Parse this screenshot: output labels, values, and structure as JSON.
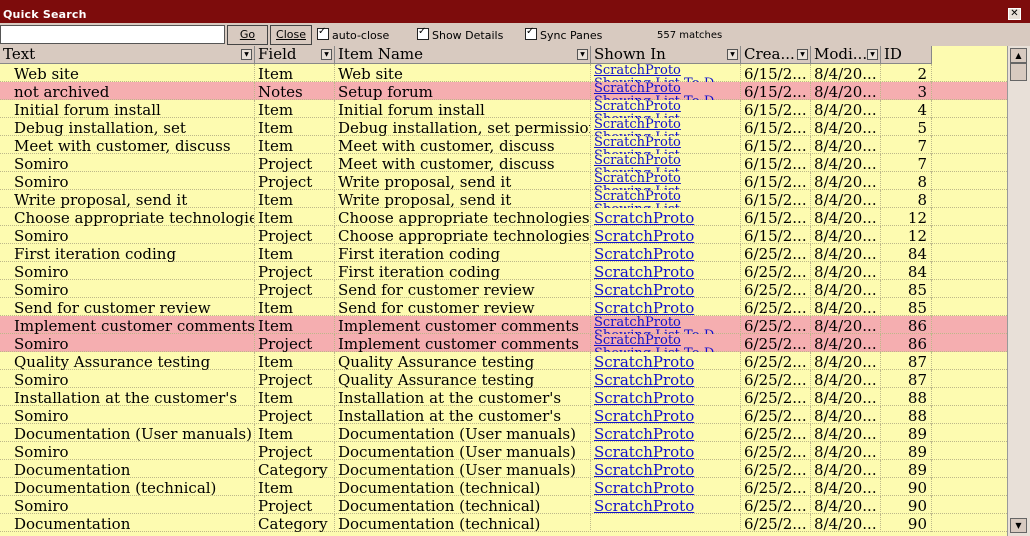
{
  "window": {
    "title": "Quick Search",
    "close_glyph": "✕"
  },
  "toolbar": {
    "search_value": "",
    "go_label": "Go",
    "close_label": "Close",
    "auto_close_label": "auto-close",
    "show_details_label": "Show Details",
    "sync_panes_label": "Sync Panes",
    "matches": "557 matches"
  },
  "columns": [
    "Text",
    "Field",
    "Item Name",
    "Shown In",
    "Crea...",
    "Modi...",
    "ID"
  ],
  "rows": [
    {
      "text": "Web site",
      "field": "Item",
      "item": "Web site",
      "shown": "ScratchProto\nShowing List To-D",
      "created": "6/15/2...",
      "modified": "8/4/20...",
      "id": "2",
      "hl": false
    },
    {
      "text": "not archived",
      "field": "Notes",
      "item": "Setup forum",
      "shown": "ScratchProto\nShowing List To-D",
      "created": "6/15/2...",
      "modified": "8/4/20...",
      "id": "3",
      "hl": true
    },
    {
      "text": "Initial forum install",
      "field": "Item",
      "item": "Initial forum install",
      "shown": "ScratchProto\nShowing List",
      "created": "6/15/2...",
      "modified": "8/4/20...",
      "id": "4",
      "hl": false
    },
    {
      "text": "Debug installation, set",
      "field": "Item",
      "item": "Debug installation, set permissions",
      "shown": "ScratchProto\nShowing List",
      "created": "6/15/2...",
      "modified": "8/4/20...",
      "id": "5",
      "hl": false
    },
    {
      "text": "Meet with customer, discuss",
      "field": "Item",
      "item": "Meet with customer, discuss",
      "shown": "ScratchProto\nShowing List",
      "created": "6/15/2...",
      "modified": "8/4/20...",
      "id": "7",
      "hl": false
    },
    {
      "text": "Somiro",
      "field": "Project",
      "item": "Meet with customer, discuss",
      "shown": "ScratchProto\nShowing List",
      "created": "6/15/2...",
      "modified": "8/4/20...",
      "id": "7",
      "hl": false
    },
    {
      "text": "Somiro",
      "field": "Project",
      "item": "Write proposal, send it",
      "shown": "ScratchProto\nShowing List",
      "created": "6/15/2...",
      "modified": "8/4/20...",
      "id": "8",
      "hl": false
    },
    {
      "text": "Write proposal, send it",
      "field": "Item",
      "item": "Write proposal, send it",
      "shown": "ScratchProto\nShowing List",
      "created": "6/15/2...",
      "modified": "8/4/20...",
      "id": "8",
      "hl": false
    },
    {
      "text": "Choose appropriate technologies",
      "field": "Item",
      "item": "Choose appropriate technologies",
      "shown": "ScratchProto",
      "created": "6/15/2...",
      "modified": "8/4/20...",
      "id": "12",
      "hl": false
    },
    {
      "text": "Somiro",
      "field": "Project",
      "item": "Choose appropriate technologies",
      "shown": "ScratchProto",
      "created": "6/15/2...",
      "modified": "8/4/20...",
      "id": "12",
      "hl": false
    },
    {
      "text": "First iteration coding",
      "field": "Item",
      "item": "First iteration coding",
      "shown": "ScratchProto",
      "created": "6/25/2...",
      "modified": "8/4/20...",
      "id": "84",
      "hl": false
    },
    {
      "text": "Somiro",
      "field": "Project",
      "item": "First iteration coding",
      "shown": "ScratchProto",
      "created": "6/25/2...",
      "modified": "8/4/20...",
      "id": "84",
      "hl": false
    },
    {
      "text": "Somiro",
      "field": "Project",
      "item": "Send for customer review",
      "shown": "ScratchProto",
      "created": "6/25/2...",
      "modified": "8/4/20...",
      "id": "85",
      "hl": false
    },
    {
      "text": "Send for customer review",
      "field": "Item",
      "item": "Send for customer review",
      "shown": "ScratchProto",
      "created": "6/25/2...",
      "modified": "8/4/20...",
      "id": "85",
      "hl": false
    },
    {
      "text": "Implement customer comments",
      "field": "Item",
      "item": "Implement customer comments",
      "shown": "ScratchProto\nShowing List To-D",
      "created": "6/25/2...",
      "modified": "8/4/20...",
      "id": "86",
      "hl": true
    },
    {
      "text": "Somiro",
      "field": "Project",
      "item": "Implement customer comments",
      "shown": "ScratchProto\nShowing List To-D",
      "created": "6/25/2...",
      "modified": "8/4/20...",
      "id": "86",
      "hl": true
    },
    {
      "text": "Quality Assurance testing",
      "field": "Item",
      "item": "Quality Assurance testing",
      "shown": "ScratchProto",
      "created": "6/25/2...",
      "modified": "8/4/20...",
      "id": "87",
      "hl": false
    },
    {
      "text": "Somiro",
      "field": "Project",
      "item": "Quality Assurance testing",
      "shown": "ScratchProto",
      "created": "6/25/2...",
      "modified": "8/4/20...",
      "id": "87",
      "hl": false
    },
    {
      "text": "Installation at the customer's",
      "field": "Item",
      "item": "Installation at the customer's",
      "shown": "ScratchProto",
      "created": "6/25/2...",
      "modified": "8/4/20...",
      "id": "88",
      "hl": false
    },
    {
      "text": "Somiro",
      "field": "Project",
      "item": "Installation at the customer's",
      "shown": "ScratchProto",
      "created": "6/25/2...",
      "modified": "8/4/20...",
      "id": "88",
      "hl": false
    },
    {
      "text": "Documentation (User manuals)",
      "field": "Item",
      "item": "Documentation (User manuals)",
      "shown": "ScratchProto",
      "created": "6/25/2...",
      "modified": "8/4/20...",
      "id": "89",
      "hl": false
    },
    {
      "text": "Somiro",
      "field": "Project",
      "item": "Documentation (User manuals)",
      "shown": "ScratchProto",
      "created": "6/25/2...",
      "modified": "8/4/20...",
      "id": "89",
      "hl": false
    },
    {
      "text": "Documentation",
      "field": "Category",
      "item": "Documentation (User manuals)",
      "shown": "ScratchProto",
      "created": "6/25/2...",
      "modified": "8/4/20...",
      "id": "89",
      "hl": false
    },
    {
      "text": "Documentation (technical)",
      "field": "Item",
      "item": "Documentation (technical)",
      "shown": "ScratchProto",
      "created": "6/25/2...",
      "modified": "8/4/20...",
      "id": "90",
      "hl": false
    },
    {
      "text": "Somiro",
      "field": "Project",
      "item": "Documentation (technical)",
      "shown": "ScratchProto",
      "created": "6/25/2...",
      "modified": "8/4/20...",
      "id": "90",
      "hl": false
    },
    {
      "text": "Documentation",
      "field": "Category",
      "item": "Documentation (technical)",
      "shown": "",
      "created": "6/25/2...",
      "modified": "8/4/20...",
      "id": "90",
      "hl": false
    }
  ],
  "icons": {
    "dropdown": "▼",
    "scroll_up": "▲",
    "scroll_down": "▼"
  }
}
